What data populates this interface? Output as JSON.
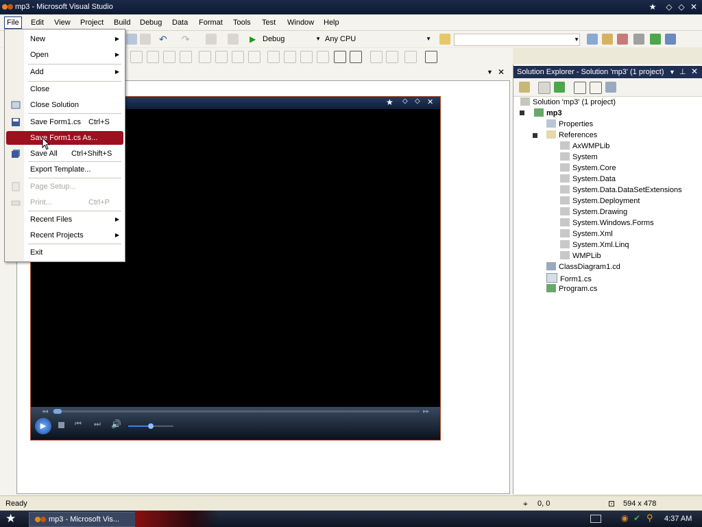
{
  "window": {
    "title": "mp3 - Microsoft Visual Studio"
  },
  "menubar": {
    "items": [
      "File",
      "Edit",
      "View",
      "Project",
      "Build",
      "Debug",
      "Data",
      "Format",
      "Tools",
      "Test",
      "Window",
      "Help"
    ]
  },
  "toolbar": {
    "config": "Debug",
    "platform": "Any CPU",
    "find_value": ""
  },
  "file_menu": {
    "items": [
      {
        "label": "New",
        "shortcut": "",
        "submenu": true,
        "disabled": false
      },
      {
        "label": "Open",
        "shortcut": "",
        "submenu": true,
        "disabled": false
      },
      {
        "label": "Add",
        "shortcut": "",
        "submenu": true,
        "disabled": false
      },
      {
        "label": "Close",
        "shortcut": "",
        "submenu": false,
        "disabled": false
      },
      {
        "label": "Close Solution",
        "shortcut": "",
        "submenu": false,
        "disabled": false
      },
      {
        "label": "Save Form1.cs",
        "shortcut": "Ctrl+S",
        "submenu": false,
        "disabled": false
      },
      {
        "label": "Save Form1.cs As...",
        "shortcut": "",
        "submenu": false,
        "disabled": false,
        "highlighted": true
      },
      {
        "label": "Save All",
        "shortcut": "Ctrl+Shift+S",
        "submenu": false,
        "disabled": false
      },
      {
        "label": "Export Template...",
        "shortcut": "",
        "submenu": false,
        "disabled": false
      },
      {
        "label": "Page Setup...",
        "shortcut": "",
        "submenu": false,
        "disabled": true
      },
      {
        "label": "Print...",
        "shortcut": "Ctrl+P",
        "submenu": false,
        "disabled": true
      },
      {
        "label": "Recent Files",
        "shortcut": "",
        "submenu": true,
        "disabled": false
      },
      {
        "label": "Recent Projects",
        "shortcut": "",
        "submenu": true,
        "disabled": false
      },
      {
        "label": "Exit",
        "shortcut": "",
        "submenu": false,
        "disabled": false
      }
    ]
  },
  "solution_explorer": {
    "title": "Solution Explorer - Solution 'mp3' (1 project)",
    "solution": "Solution 'mp3' (1 project)",
    "project": "mp3",
    "nodes": {
      "properties": "Properties",
      "references": "References",
      "refs": [
        "AxWMPLib",
        "System",
        "System.Core",
        "System.Data",
        "System.Data.DataSetExtensions",
        "System.Deployment",
        "System.Drawing",
        "System.Windows.Forms",
        "System.Xml",
        "System.Xml.Linq",
        "WMPLib"
      ],
      "files": [
        "ClassDiagram1.cd",
        "Form1.cs",
        "Program.cs"
      ]
    }
  },
  "statusbar": {
    "text": "Ready",
    "position": "0, 0",
    "size": "594 x 478"
  },
  "taskbar": {
    "task_label": "mp3 - Microsoft Vis...",
    "clock": "4:37 AM"
  },
  "colors": {
    "titlebar": "#0d1a33",
    "highlight": "#9c1020",
    "panel": "#f4f3ee",
    "accent": "#b3502b"
  }
}
